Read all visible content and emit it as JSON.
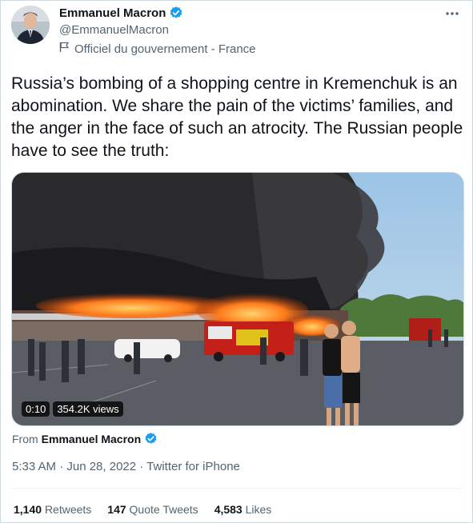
{
  "author": {
    "display_name": "Emmanuel Macron",
    "handle": "@EmmanuelMacron",
    "affiliation": "Officiel du gouvernement - France",
    "verified": true
  },
  "tweet": {
    "text": "Russia’s bombing of a shopping centre in Kremenchuk is an abomination. We share the pain of the victims’ families, and the anger in the face of such an atrocity. The Russian people have to see the truth:"
  },
  "media": {
    "type": "video",
    "duration": "0:10",
    "views": "354.2K views"
  },
  "attribution": {
    "prefix": "From",
    "source": "Emmanuel Macron"
  },
  "meta": {
    "timestamp": "5:33 AM · Jun 28, 2022 · Twitter for iPhone"
  },
  "stats": {
    "retweets_count": "1,140",
    "retweets_label": "Retweets",
    "quotes_count": "147",
    "quotes_label": "Quote Tweets",
    "likes_count": "4,583",
    "likes_label": "Likes"
  },
  "colors": {
    "verified_blue": "#1d9bf0",
    "secondary_text": "#536471",
    "primary_text": "#0f1419"
  },
  "icons": {
    "more": "more-options-icon",
    "affiliation": "flag-icon",
    "verified": "verified-badge-icon"
  }
}
